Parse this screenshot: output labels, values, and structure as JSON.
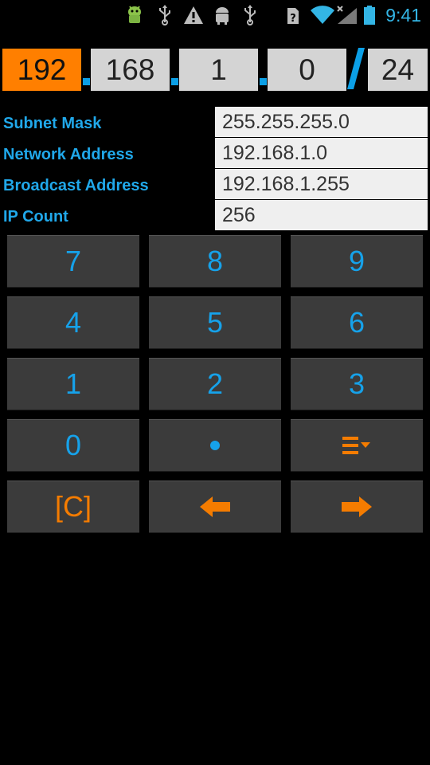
{
  "status_bar": {
    "time": "9:41",
    "icons": [
      "android-debug-icon",
      "usb-icon",
      "warning-icon",
      "android-icon",
      "usb-icon",
      "sim-unknown-icon",
      "wifi-icon",
      "signal-no-data-icon",
      "battery-icon"
    ]
  },
  "ip_input": {
    "octets": [
      "192",
      "168",
      "1",
      "0"
    ],
    "separator": "/",
    "prefix": "24",
    "active_octet": 0
  },
  "results": [
    {
      "label": "Subnet Mask",
      "value": "255.255.255.0"
    },
    {
      "label": "Network Address",
      "value": "192.168.1.0"
    },
    {
      "label": "Broadcast Address",
      "value": "192.168.1.255"
    },
    {
      "label": "IP Count",
      "value": "256"
    }
  ],
  "keypad": {
    "k7": "7",
    "k8": "8",
    "k9": "9",
    "k4": "4",
    "k5": "5",
    "k6": "6",
    "k1": "1",
    "k2": "2",
    "k3": "3",
    "k0": "0",
    "dot_icon": "dot-icon",
    "menu_icon": "menu-dropdown-icon",
    "clear": "[C]",
    "left_icon": "arrow-left-icon",
    "right_icon": "arrow-right-icon"
  },
  "colors": {
    "accent_blue": "#16a2ea",
    "accent_orange": "#f57c00",
    "active_field": "#ff7f00",
    "key_bg": "#3b3b3b",
    "field_bg": "#d4d4d4"
  }
}
